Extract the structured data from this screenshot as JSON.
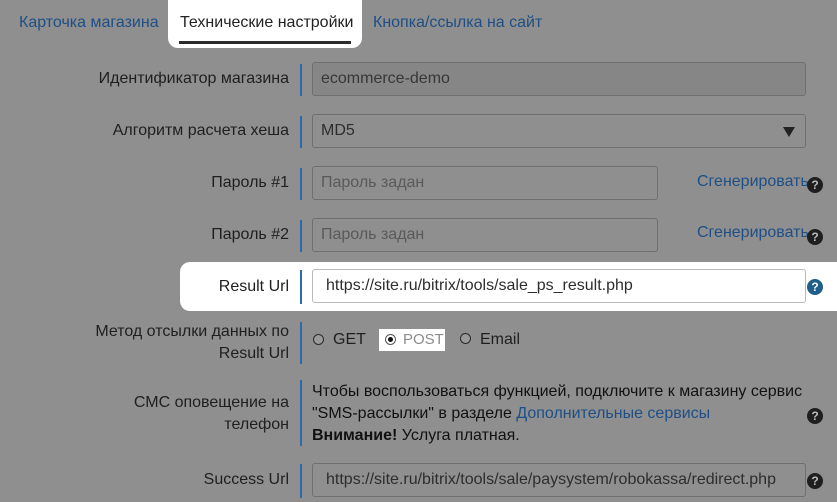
{
  "tabs": {
    "store_card": "Карточка магазина",
    "tech_settings": "Технические настройки",
    "button_link": "Кнопка/ссылка на сайт"
  },
  "form": {
    "store_id": {
      "label": "Идентификатор магазина",
      "value": "ecommerce-demo"
    },
    "hash_algo": {
      "label": "Алгоритм расчета хеша",
      "value": "MD5"
    },
    "password1": {
      "label": "Пароль #1",
      "placeholder": "Пароль задан",
      "generate": "Сгенерировать"
    },
    "password2": {
      "label": "Пароль #2",
      "placeholder": "Пароль задан",
      "generate": "Сгенерировать"
    },
    "result_url": {
      "label": "Result Url",
      "value": "https://site.ru/bitrix/tools/sale_ps_result.php"
    },
    "send_method": {
      "label_line1": "Метод отсылки данных по",
      "label_line2": "Result Url",
      "options": [
        "GET",
        "POST",
        "Email"
      ],
      "selected": "POST"
    },
    "sms": {
      "label_line1": "СМС оповещение на",
      "label_line2": "телефон",
      "text_part1": "Чтобы воспользоваться функцией, подключите к магазину сервис \"SMS-рассылки\" в разделе",
      "link": "Дополнительные сервисы",
      "warning_bold": "Внимание!",
      "warning_text": "Услуга платная."
    },
    "success_url": {
      "label": "Success Url",
      "value": "https://site.ru/bitrix/tools/sale/paysystem/robokassa/redirect.php"
    }
  },
  "help_glyph": "?",
  "colors": {
    "link": "#1d4f86",
    "accent_bar": "#2e6aa8",
    "overlay": "#8f8f8f"
  }
}
